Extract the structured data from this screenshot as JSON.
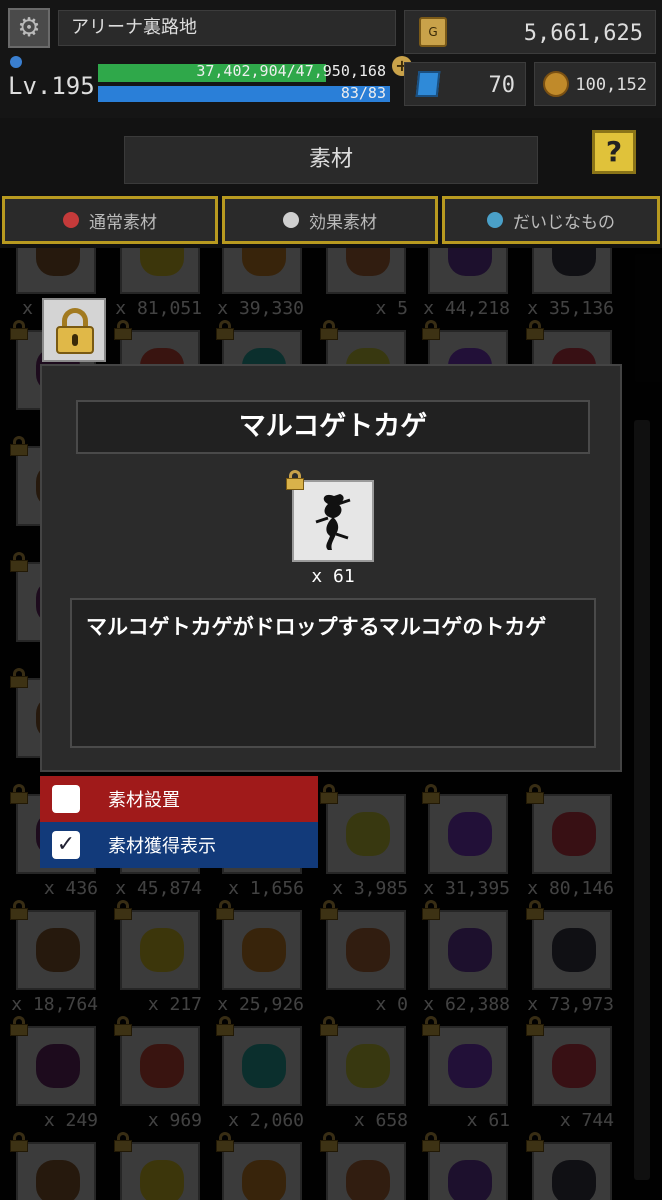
{
  "status": {
    "location": "アリーナ裏路地",
    "gold": "5,661,625",
    "gold_icon_text": "G",
    "level": "Lv.195",
    "exp": "37,402,904/47,950,168",
    "exp_fraction": 0.78,
    "hp": "83/83",
    "hp_fraction": 1.0,
    "gems": "70",
    "coins": "100,152"
  },
  "header": {
    "title": "素材",
    "help": "?"
  },
  "tabs": [
    {
      "label": "通常素材",
      "color": "#c43a3a"
    },
    {
      "label": "効果素材",
      "color": "#cfcfcf"
    },
    {
      "label": "だいじなもの",
      "color": "#4aa0c8"
    }
  ],
  "grid_rows": [
    {
      "counts": [
        "x 1,234",
        "x 81,051",
        "x 39,330",
        "x 5",
        "x 44,218",
        "x 35,136"
      ]
    },
    {
      "counts": [
        "",
        "",
        "",
        "",
        "",
        ""
      ]
    },
    {
      "counts": [
        "",
        "",
        "",
        "",
        "",
        ""
      ]
    },
    {
      "counts": [
        "",
        "",
        "",
        "",
        "",
        ""
      ]
    },
    {
      "counts": [
        "",
        "",
        "",
        "",
        "",
        ""
      ]
    },
    {
      "counts": [
        "x 436",
        "x 45,874",
        "x 1,656",
        "x 3,985",
        "x 31,395",
        "x 80,146"
      ]
    },
    {
      "counts": [
        "x 18,764",
        "x 217",
        "x 25,926",
        "x 0",
        "x 62,388",
        "x 73,973"
      ]
    },
    {
      "counts": [
        "x 249",
        "x 969",
        "x 2,060",
        "x 658",
        "x 61",
        "x 744"
      ]
    },
    {
      "counts": [
        "",
        "",
        "",
        "",
        "",
        ""
      ]
    }
  ],
  "item_colors": [
    "#8a5a30",
    "#d8c02a",
    "#c8802a",
    "#b0683a",
    "#6a3aa0",
    "#3a3a4a",
    "#6a2a6a",
    "#cc4a3a",
    "#2aa8a0",
    "#c8c83a",
    "#7a3ac8",
    "#c83a4a"
  ],
  "modal": {
    "title": "マルコゲトカゲ",
    "count": "x 61",
    "description": "マルコゲトカゲがドロップするマルコゲのトカゲ"
  },
  "toggles": [
    {
      "label": "素材設置",
      "checked": false,
      "color": "#a01a1a"
    },
    {
      "label": "素材獲得表示",
      "checked": true,
      "color": "#123a7a"
    }
  ]
}
